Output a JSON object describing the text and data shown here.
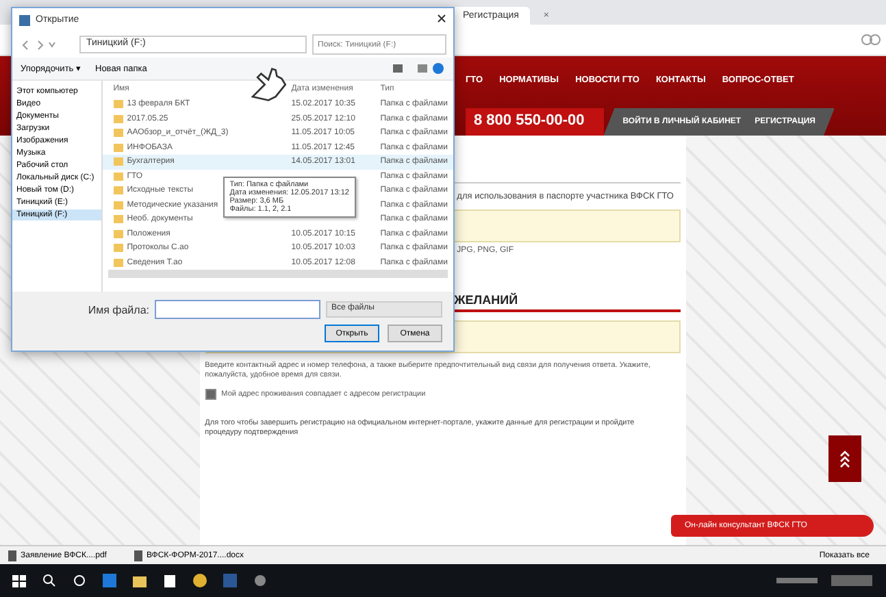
{
  "browser": {
    "tabs": [
      {
        "label": "Регистрация",
        "selected": true
      },
      {
        "label": "×",
        "selected": false
      }
    ],
    "nav_links": [
      "ГТО",
      "НОРМАТИВЫ",
      "НОВОСТИ ГТО",
      "КОНТАКТЫ",
      "ВОПРОС-ОТВЕТ"
    ],
    "phone": "8 800 550-00-00",
    "account_links": [
      "ВОЙТИ В ЛИЧНЫЙ КАБИНЕТ",
      "РЕГИСТРАЦИЯ"
    ],
    "photo_note": "для использования в паспорте участника ВФСК ГТО",
    "format_note": "JPG, PNG, GIF",
    "section_heading": "ЖЕЛАНИЙ",
    "hint": "Введите контактный адрес и номер телефона, а также выберите предпочтительный вид связи для получения ответа. Укажите, пожалуйста, удобное время для связи.",
    "consent": {
      "label": "Мой адрес проживания совпадает с адресом регистрации",
      "checked": true
    },
    "notice": "Для того чтобы завершить регистрацию на официальном интернет-портале, укажите данные для регистрации и пройдите процедуру подтверждения",
    "chat": "Он-лайн консультант ВФСК ГТО",
    "downloads": [
      "Заявление ВФСК....pdf",
      "ВФСК-ФОРМ-2017....docx"
    ],
    "show_all": "Показать все"
  },
  "dialog": {
    "title": "Открытие",
    "path": "Тиницкий (F:)",
    "search_placeholder": "Поиск: Тиницкий (F:)",
    "toolbar": [
      "Упорядочить ▾",
      "Новая папка"
    ],
    "nav": [
      {
        "label": "Этот компьютер",
        "selected": false
      },
      {
        "label": "Видео",
        "selected": false
      },
      {
        "label": "Документы",
        "selected": false
      },
      {
        "label": "Загрузки",
        "selected": false
      },
      {
        "label": "Изображения",
        "selected": false
      },
      {
        "label": "Музыка",
        "selected": false
      },
      {
        "label": "Рабочий стол",
        "selected": false
      },
      {
        "label": "Локальный диск (C:)",
        "selected": false
      },
      {
        "label": "Новый том (D:)",
        "selected": false
      },
      {
        "label": "Тиницкий (E:)",
        "selected": false
      },
      {
        "label": "Тиницкий (F:)",
        "selected": true
      }
    ],
    "columns": [
      "Имя",
      "Дата изменения",
      "Тип"
    ],
    "files": [
      {
        "name": "13 февраля БКТ",
        "date": "15.02.2017 10:35",
        "type": "Папка с файлами",
        "selected": false
      },
      {
        "name": "2017.05.25",
        "date": "25.05.2017 12:10",
        "type": "Папка с файлами",
        "selected": false
      },
      {
        "name": "ААОбзор_и_отчёт_(ЖД_3)",
        "date": "11.05.2017 10:05",
        "type": "Папка с файлами",
        "selected": false
      },
      {
        "name": "ИНФОБАЗА",
        "date": "11.05.2017 12:45",
        "type": "Папка с файлами",
        "selected": false
      },
      {
        "name": "Бухгалтерия",
        "date": "14.05.2017 13:01",
        "type": "Папка с файлами",
        "selected": true
      },
      {
        "name": "ГТО",
        "type": "Папка с файлами",
        "selected": false
      },
      {
        "name": "Исходные тексты",
        "type": "Папка с файлами",
        "selected": false
      },
      {
        "name": "Методические указания",
        "type": "Папка с файлами",
        "selected": false
      },
      {
        "name": "Необ. документы",
        "type": "Папка с файлами",
        "selected": false
      },
      {
        "name": "Положения",
        "date": "10.05.2017 10:15",
        "type": "Папка с файлами",
        "selected": false
      },
      {
        "name": "Протоколы С.ао",
        "date": "10.05.2017 10:03",
        "type": "Папка с файлами",
        "selected": false
      },
      {
        "name": "Сведения Т.ао",
        "date": "10.05.2017 12:08",
        "type": "Папка с файлами",
        "selected": false
      }
    ],
    "tooltip": [
      "Тип: Папка с файлами",
      "Дата изменения: 12.05.2017 13:12",
      "Размер: 3,6 МБ",
      "Файлы: 1.1, 2, 2.1"
    ],
    "filename_label": "Имя файла:",
    "filetype": "Все файлы",
    "buttons": [
      "Открыть",
      "Отмена"
    ]
  }
}
